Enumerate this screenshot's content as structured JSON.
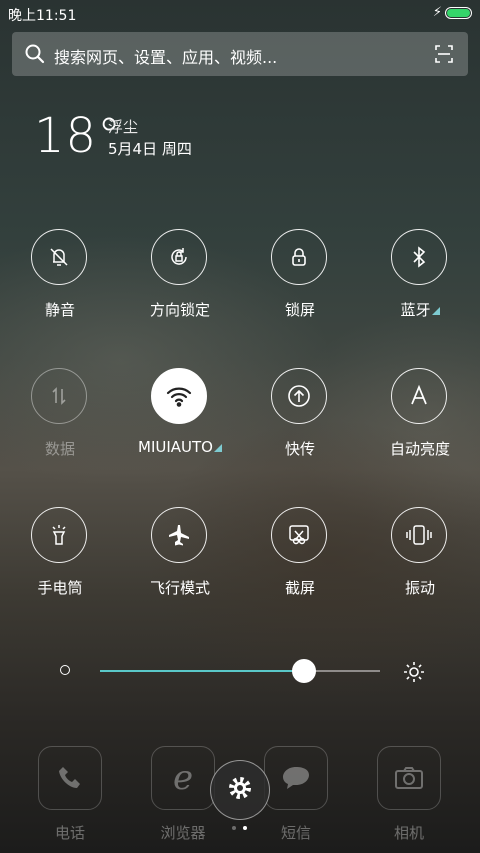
{
  "status_bar": {
    "time": "晚上11:51",
    "charging": "⚡",
    "battery_level": 1.0,
    "battery_color": "#35d56a"
  },
  "search": {
    "placeholder": "搜索网页、设置、应用、视频..."
  },
  "weather": {
    "temperature": "18°",
    "condition": "浮尘",
    "date": "5月4日 周四"
  },
  "toggles": [
    {
      "label": "静音",
      "icon": "bell-off-icon",
      "active": false
    },
    {
      "label": "方向锁定",
      "icon": "rotation-lock-icon",
      "active": false
    },
    {
      "label": "锁屏",
      "icon": "lock-icon",
      "active": false
    },
    {
      "label": "蓝牙",
      "icon": "bluetooth-icon",
      "active": false,
      "has_submenu": true
    },
    {
      "label": "数据",
      "icon": "mobile-data-icon",
      "active": false,
      "disabled": true
    },
    {
      "label": "MIUIAUTO",
      "icon": "wifi-icon",
      "active": true,
      "has_submenu": true
    },
    {
      "label": "快传",
      "icon": "upload-icon",
      "active": false
    },
    {
      "label": "自动亮度",
      "icon": "auto-brightness-icon",
      "active": false
    },
    {
      "label": "手电筒",
      "icon": "flashlight-icon",
      "active": false
    },
    {
      "label": "飞行模式",
      "icon": "airplane-icon",
      "active": false
    },
    {
      "label": "截屏",
      "icon": "scissors-icon",
      "active": false
    },
    {
      "label": "振动",
      "icon": "vibrate-icon",
      "active": false
    }
  ],
  "brightness": {
    "value": 0.73,
    "accent": "#5ac8c8"
  },
  "dock": {
    "apps": [
      {
        "label": "电话",
        "icon": "phone-icon"
      },
      {
        "label": "浏览器",
        "icon": "browser-icon"
      },
      {
        "label": "短信",
        "icon": "message-icon"
      },
      {
        "label": "相机",
        "icon": "camera-icon"
      }
    ],
    "settings_icon": "gear-icon"
  }
}
